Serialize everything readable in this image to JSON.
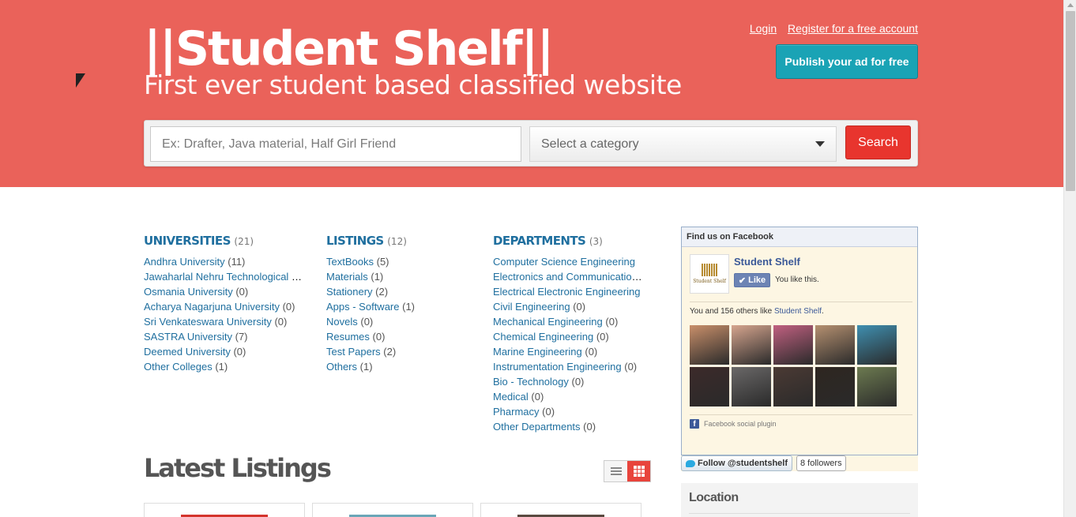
{
  "header": {
    "logo": "||Student Shelf||",
    "tagline": "First ever student based classified website",
    "login_label": "Login",
    "register_label": "Register for a free account",
    "publish_label": "Publish your ad for free",
    "bg_color": "#ea625a"
  },
  "search": {
    "placeholder": "Ex: Drafter, Java material, Half Girl Friend",
    "category_label": "Select a category",
    "button_label": "Search"
  },
  "categories": {
    "universities": {
      "title": "UNIVERSITIES",
      "count": "(21)",
      "items": [
        {
          "label": "Andhra University",
          "count": "(11)"
        },
        {
          "label": "Jawaharlal Nehru Technological University",
          "count": ""
        },
        {
          "label": "Osmania University",
          "count": "(0)"
        },
        {
          "label": "Acharya Nagarjuna University",
          "count": "(0)"
        },
        {
          "label": "Sri Venkateswara University",
          "count": "(0)"
        },
        {
          "label": "SASTRA University",
          "count": "(7)"
        },
        {
          "label": "Deemed University",
          "count": "(0)"
        },
        {
          "label": "Other Colleges",
          "count": "(1)"
        }
      ]
    },
    "listings": {
      "title": "LISTINGS",
      "count": "(12)",
      "items": [
        {
          "label": "TextBooks",
          "count": "(5)"
        },
        {
          "label": "Materials",
          "count": "(1)"
        },
        {
          "label": "Stationery",
          "count": "(2)"
        },
        {
          "label": "Apps - Software",
          "count": "(1)"
        },
        {
          "label": "Novels",
          "count": "(0)"
        },
        {
          "label": "Resumes",
          "count": "(0)"
        },
        {
          "label": "Test Papers",
          "count": "(2)"
        },
        {
          "label": "Others",
          "count": "(1)"
        }
      ]
    },
    "departments": {
      "title": "DEPARTMENTS",
      "count": "(3)",
      "items": [
        {
          "label": "Computer Science Engineering",
          "count": ""
        },
        {
          "label": "Electronics and Communication Engineering",
          "count": ""
        },
        {
          "label": "Electrical Electronic Engineering",
          "count": ""
        },
        {
          "label": "Civil Engineering",
          "count": "(0)"
        },
        {
          "label": "Mechanical Engineering",
          "count": "(0)"
        },
        {
          "label": "Chemical Engineering",
          "count": "(0)"
        },
        {
          "label": "Marine Engineering",
          "count": "(0)"
        },
        {
          "label": "Instrumentation Engineering",
          "count": "(0)"
        },
        {
          "label": "Bio - Technology",
          "count": "(0)"
        },
        {
          "label": "Medical",
          "count": "(0)"
        },
        {
          "label": "Pharmacy",
          "count": "(0)"
        },
        {
          "label": "Other Departments",
          "count": "(0)"
        }
      ]
    }
  },
  "latest": {
    "title": "Latest Listings",
    "list_view_icon": "list-icon",
    "grid_view_icon": "grid-icon"
  },
  "facebook": {
    "header": "Find us on Facebook",
    "page_name": "Student Shelf",
    "logo_text": "Student Shelf",
    "like_label": "Like",
    "like_text": "You like this.",
    "count_prefix": "You and 156 others like ",
    "count_link": "Student Shelf",
    "count_suffix": ".",
    "plugin_label": "Facebook social plugin",
    "faces": [
      "#c98f6a",
      "#d6a58e",
      "#c06080",
      "#b59070",
      "#3f8fb0",
      "#3c2a2a",
      "#6a6868",
      "#4b3a34",
      "#2e2620",
      "#6c7a50"
    ]
  },
  "twitter": {
    "follow_label": "Follow @studentshelf",
    "followers": "8 followers"
  },
  "sidebar": {
    "location_title": "Location"
  }
}
